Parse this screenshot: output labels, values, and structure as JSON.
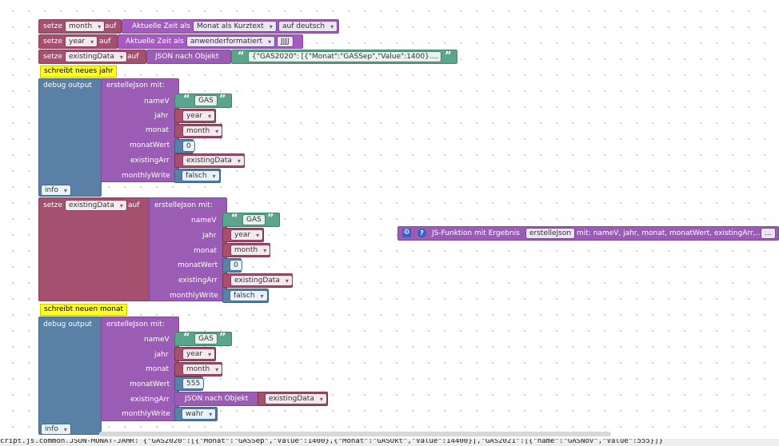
{
  "row1": {
    "setze": "setze",
    "var": "month",
    "auf": "auf",
    "label": "Aktuelle Zeit als",
    "format": "Monat als Kurztext",
    "lang": "auf deutsch"
  },
  "row2": {
    "setze": "setze",
    "var": "year",
    "auf": "auf",
    "label": "Aktuelle Zeit als",
    "format": "anwenderformatiert",
    "pattern": "JJJJ"
  },
  "row3": {
    "setze": "setze",
    "var": "existingData",
    "auf": "auf",
    "label": "JSON nach Objekt",
    "open_quote": "“",
    "value": "{\"GAS2020\":    [{\"Monat\":\"GASSep\",\"Value\":1400}.…",
    "close_quote": "”"
  },
  "comment1": "schreibt neues jahr",
  "debug1": {
    "label": "debug output",
    "call": "erstelleJson  mit:",
    "p_name": "nameV",
    "p_jahr": "jahr",
    "p_monat": "monat",
    "p_monatwert": "monatWert",
    "p_existing": "existingArr",
    "p_monthly": "monthlyWrite",
    "v_name": "GAS",
    "v_jahr": "year",
    "v_monat": "month",
    "v_monatwert": "0",
    "v_existing": "existingData",
    "v_monthly": "falsch",
    "level": "info"
  },
  "set2": {
    "setze": "setze",
    "var": "existingData",
    "auf": "auf",
    "call": "erstelleJson  mit:",
    "p_name": "nameV",
    "p_jahr": "jahr",
    "p_monat": "monat",
    "p_monatwert": "monatWert",
    "p_existing": "existingArr",
    "p_monthly": "monthlyWrite",
    "v_name": "GAS",
    "v_jahr": "year",
    "v_monat": "month",
    "v_monatwert": "0",
    "v_existing": "existingData",
    "v_monthly": "falsch"
  },
  "comment2": "schreibt neuen monat",
  "debug2": {
    "label": "debug output",
    "call": "erstelleJson  mit:",
    "p_name": "nameV",
    "p_jahr": "jahr",
    "p_monat": "monat",
    "p_monatwert": "monatWert",
    "p_existing": "existingArr",
    "p_monthly": "monthlyWrite",
    "v_name": "GAS",
    "v_jahr": "year",
    "v_monat": "month",
    "v_monatwert": "555",
    "json_label": "JSON nach Objekt",
    "v_existing": "existingData",
    "v_monthly": "wahr",
    "level": "info"
  },
  "func": {
    "label": "JS-Funktion mit Ergebnis",
    "name": "erstelleJson",
    "params": "mit: nameV, jahr, monat, monatWert, existingArr,…",
    "more": "..."
  },
  "statusbar": "cript.js.common.JSON-MONAT-JAHR: {\"GAS2020\":[{\"Monat\":\"GASSep\",\"Value\":1400},{\"Monat\":\"GASOkt\",\"Value\":14400}],\"GAS2021\":[{\"name\":\"GASNov\",\"Value\":555}]}",
  "colors": {
    "variable": "#a5506f",
    "timeblock": "#a55bbf",
    "function": "#9a5cb4",
    "debug": "#5b80a5",
    "text": "#5ba58c",
    "comment": "#ffff22"
  }
}
